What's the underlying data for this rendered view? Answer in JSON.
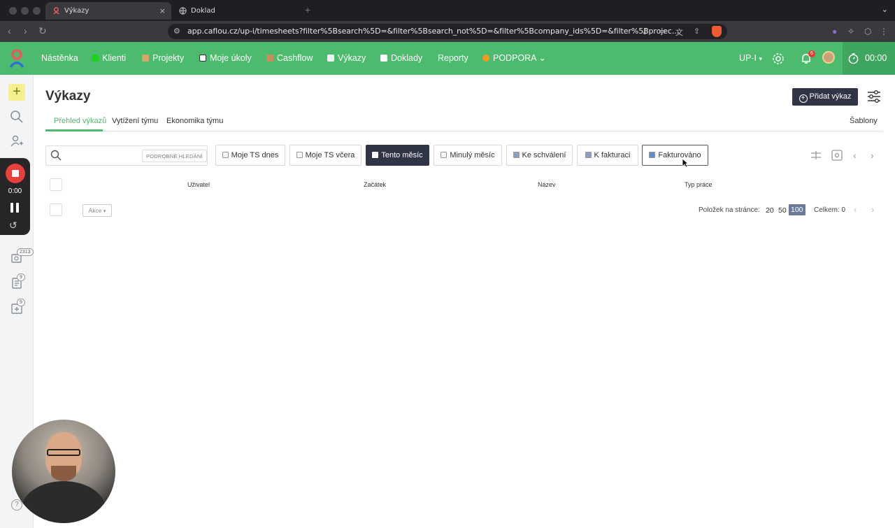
{
  "browser": {
    "tabs": [
      {
        "title": "Výkazy",
        "active": true
      },
      {
        "title": "Doklad",
        "active": false
      }
    ],
    "close_glyph": "×",
    "new_tab_glyph": "+",
    "url": "app.caflou.cz/up-i/timesheets?filter%5Bsearch%5D=&filter%5Bsearch_not%5D=&filter%5Bcompany_ids%5D=&filter%5Bprojec..."
  },
  "appbar": {
    "nav": [
      {
        "label": "Nástěnka",
        "icon": null
      },
      {
        "label": "Klienti",
        "icon": "clients-icon",
        "color": "#19d219"
      },
      {
        "label": "Projekty",
        "icon": "folder-icon",
        "color": "#d9a46a"
      },
      {
        "label": "Moje úkoly",
        "icon": "checkbox-icon",
        "color": "#ffffff"
      },
      {
        "label": "Cashflow",
        "icon": "money-icon",
        "color": "#c98e5a"
      },
      {
        "label": "Výkazy",
        "icon": "timesheet-icon",
        "color": "#f2f2f2"
      },
      {
        "label": "Doklady",
        "icon": "document-icon",
        "color": "#ffffff"
      },
      {
        "label": "Reporty",
        "icon": null
      },
      {
        "label": "PODPORA",
        "icon": "orange-dot-icon",
        "color": "#f39b1c"
      }
    ],
    "company": "UP-I",
    "notifications_count": "6",
    "timer": "00:00",
    "accent": "#4dbb6e"
  },
  "rail": {
    "badges": [
      "2313",
      "9",
      "9"
    ],
    "recorder_time": "0:00",
    "help": "?"
  },
  "page": {
    "title": "Výkazy",
    "add_button": "Přidat výkaz",
    "add_glyph": "+",
    "subtabs": [
      "Přehled výkazů",
      "Vytížení týmu",
      "Ekonomika týmu"
    ],
    "templates": "Šablony",
    "advanced_search": "PODROBNÉ HLEDÁNÍ",
    "search_placeholder": "",
    "filters": [
      {
        "label": "Moje TS dnes",
        "state": "normal"
      },
      {
        "label": "Moje TS včera",
        "state": "normal"
      },
      {
        "label": "Tento měsíc",
        "state": "selected"
      },
      {
        "label": "Minulý měsíc",
        "state": "normal"
      },
      {
        "label": "Ke schválení",
        "state": "normal"
      },
      {
        "label": "K fakturaci",
        "state": "normal"
      },
      {
        "label": "Fakturováno",
        "state": "outlined"
      }
    ],
    "columns": [
      "Uživatel",
      "Začátek",
      "Název",
      "Typ práce"
    ],
    "actions_label": "Akce",
    "per_page_label": "Položek na stránce:",
    "per_page_options": [
      "20",
      "50",
      "100"
    ],
    "per_page_selected": "100",
    "total": "Celkem: 0"
  }
}
